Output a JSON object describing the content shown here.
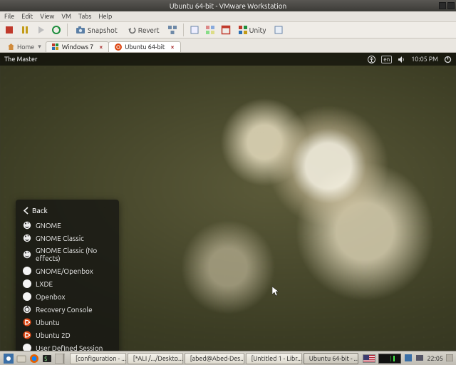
{
  "vmware": {
    "title": "Ubuntu 64-bit - VMware Workstation",
    "menu": [
      "File",
      "Edit",
      "View",
      "VM",
      "Tabs",
      "Help"
    ],
    "toolbar": {
      "snapshot": "Snapshot",
      "revert": "Revert",
      "unity": "Unity"
    },
    "tabs": {
      "home": "Home",
      "items": [
        {
          "label": "Windows 7",
          "active": false
        },
        {
          "label": "Ubuntu 64-bit",
          "active": true
        }
      ]
    }
  },
  "guest": {
    "user": "The Master",
    "indicators": {
      "lang": "en",
      "time": "10:05 PM"
    },
    "back": "Back",
    "sessions": [
      {
        "label": "GNOME",
        "icon": "gnome"
      },
      {
        "label": "GNOME Classic",
        "icon": "gnome"
      },
      {
        "label": "GNOME Classic (No effects)",
        "icon": "gnome"
      },
      {
        "label": "GNOME/Openbox",
        "icon": "dot"
      },
      {
        "label": "LXDE",
        "icon": "dot"
      },
      {
        "label": "Openbox",
        "icon": "dot"
      },
      {
        "label": "Recovery Console",
        "icon": "recover"
      },
      {
        "label": "Ubuntu",
        "icon": "ubuntu"
      },
      {
        "label": "Ubuntu 2D",
        "icon": "ubuntu"
      },
      {
        "label": "User Defined Session",
        "icon": "dot"
      }
    ]
  },
  "host_taskbar": {
    "tasks": [
      {
        "label": "[configuration - ...",
        "active": false
      },
      {
        "label": "[*ALI /.../Deskto...",
        "active": false
      },
      {
        "label": "[abed@Abed-Des...",
        "active": false
      },
      {
        "label": "[Untitled 1 - Libr...",
        "active": false
      },
      {
        "label": "Ubuntu 64-bit - ...",
        "active": true
      }
    ],
    "clock": "22:05"
  }
}
